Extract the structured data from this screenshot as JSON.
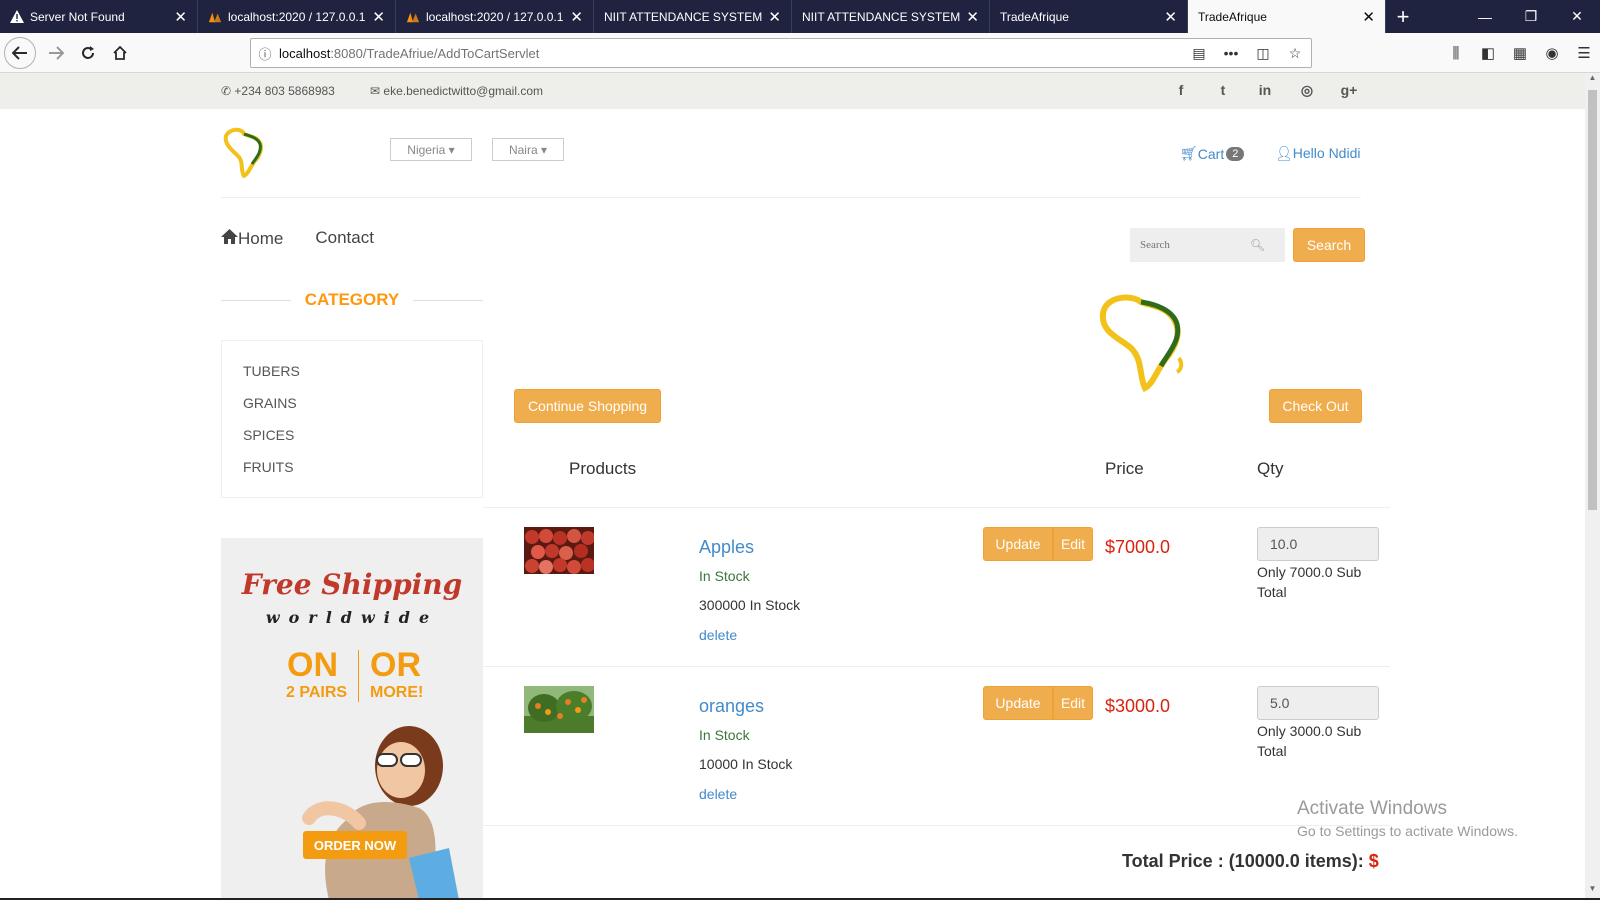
{
  "browser": {
    "tabs": [
      {
        "title": "Server Not Found",
        "icon": "warning-icon",
        "active": false
      },
      {
        "title": "localhost:2020 / 127.0.0.1 / ",
        "icon": "phpmyadmin-icon",
        "active": false
      },
      {
        "title": "localhost:2020 / 127.0.0.1 / ",
        "icon": "phpmyadmin-icon",
        "active": false
      },
      {
        "title": "NIIT ATTENDANCE SYSTEM",
        "icon": "",
        "active": false
      },
      {
        "title": "NIIT ATTENDANCE SYSTEM",
        "icon": "",
        "active": false
      },
      {
        "title": "TradeAfrique",
        "icon": "",
        "active": false
      },
      {
        "title": "TradeAfrique",
        "icon": "",
        "active": true
      }
    ],
    "url_host": "localhost",
    "url_path": ":8080/TradeAfriue/AddToCartServlet"
  },
  "topbar": {
    "phone": "+234 803 5868983",
    "email": "eke.benedictwitto@gmail.com",
    "social": [
      "f",
      "t",
      "in",
      "dribbble",
      "g+"
    ]
  },
  "header": {
    "country": "Nigeria",
    "currency": "Naira",
    "cart_label": "Cart",
    "cart_count": "2",
    "greeting": "Hello Ndidi"
  },
  "nav": {
    "home": "Home",
    "contact": "Contact",
    "search_placeholder": "Search",
    "search_button": "Search"
  },
  "sidebar": {
    "category_title": "CATEGORY",
    "categories": [
      "TUBERS",
      "GRAINS",
      "SPICES",
      "FRUITS"
    ]
  },
  "ad": {
    "line1": "Free Shipping",
    "line2": "worldwide",
    "on": "ON",
    "or": "OR",
    "pairs": "2 PAIRS",
    "more": "MORE!",
    "cta": "ORDER NOW"
  },
  "cart": {
    "continue_label": "Continue Shopping",
    "checkout_label": "Check Out",
    "col_products": "Products",
    "col_price": "Price",
    "col_qty": "Qty",
    "items": [
      {
        "name": "Apples",
        "availability": "In Stock",
        "stock": "300000 In Stock",
        "delete": "delete",
        "update": "Update",
        "edit": "Edit",
        "price": "$7000.0",
        "qty": "10.0",
        "subtotal": "Only 7000.0 Sub Total"
      },
      {
        "name": "oranges",
        "availability": "In Stock",
        "stock": "10000 In Stock",
        "delete": "delete",
        "update": "Update",
        "edit": "Edit",
        "price": "$3000.0",
        "qty": "5.0",
        "subtotal": "Only 3000.0 Sub Total"
      }
    ],
    "total_label": "Total Price : (10000.0 items): ",
    "total_currency": "$"
  },
  "watermark": {
    "title": "Activate Windows",
    "subtitle": "Go to Settings to activate Windows."
  }
}
